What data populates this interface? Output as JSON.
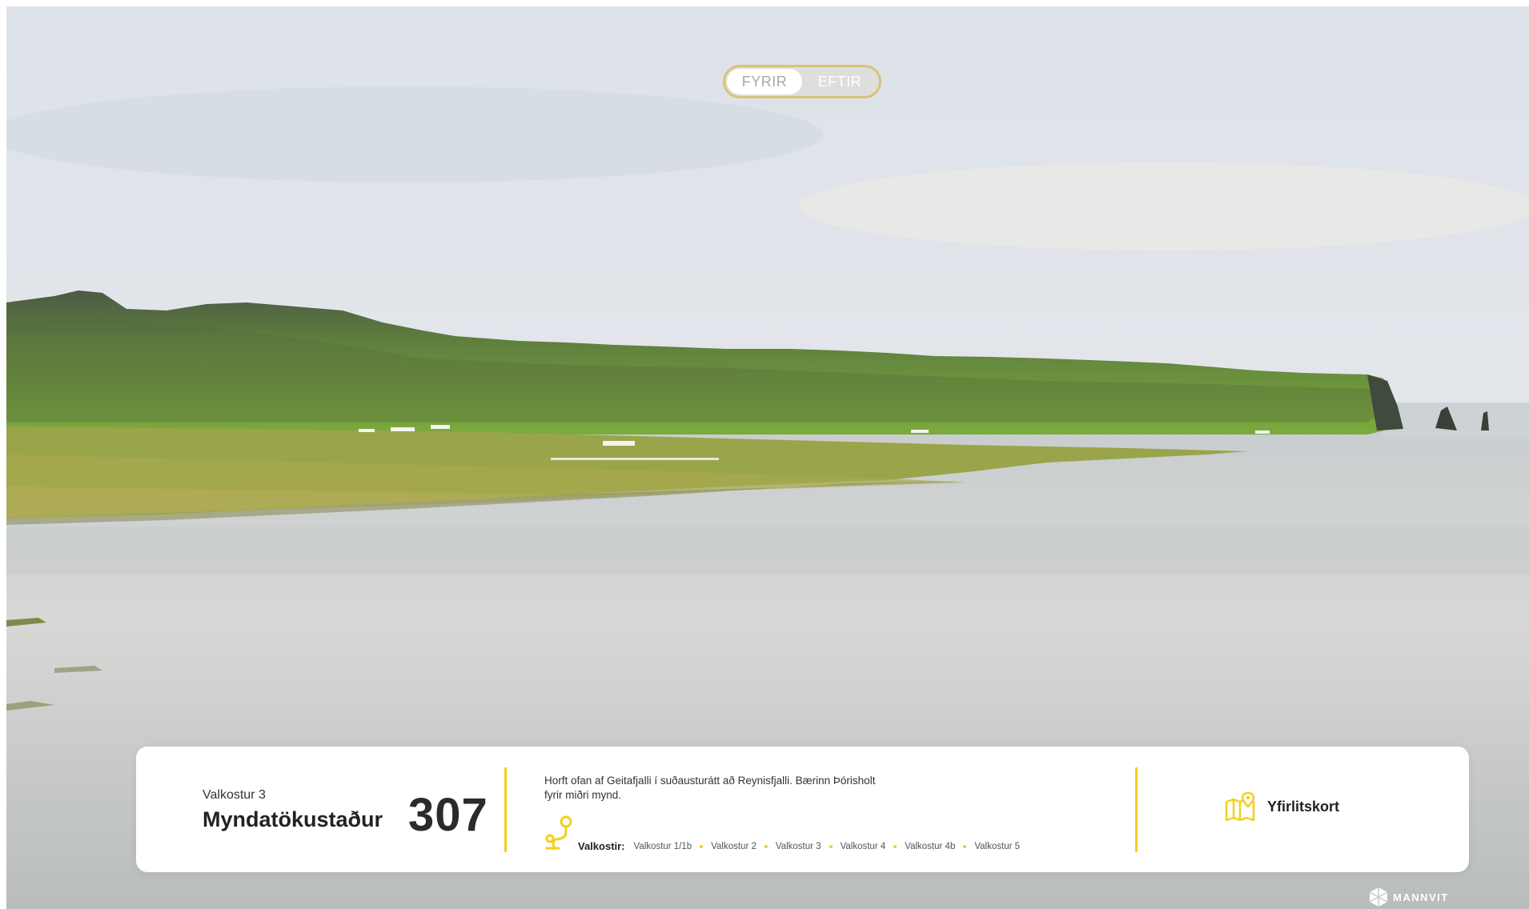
{
  "toggle": {
    "before_label": "FYRIR",
    "after_label": "EFTIR",
    "selected": "FYRIR"
  },
  "location": {
    "option_label": "Valkostur 3",
    "title": "Myndatökustaður",
    "number": "307",
    "description": "Horft ofan af Geitafjalli í suðausturátt að Reynisfjalli. Bærinn Þórisholt fyrir miðri mynd."
  },
  "options": {
    "label": "Valkostir:",
    "items": [
      "Valkostur 1/1b",
      "Valkostur 2",
      "Valkostur 3",
      "Valkostur 4",
      "Valkostur 4b",
      "Valkostur 5"
    ]
  },
  "map_link": {
    "label": "Yfirlitskort",
    "icon": "map-pin-icon"
  },
  "brand": {
    "name": "MANNVIT",
    "icon": "mannvit-logo-icon"
  },
  "colors": {
    "accent": "#f3cf1d",
    "panel_bg": "#ffffff",
    "toggle_border": "#d9c27a"
  }
}
